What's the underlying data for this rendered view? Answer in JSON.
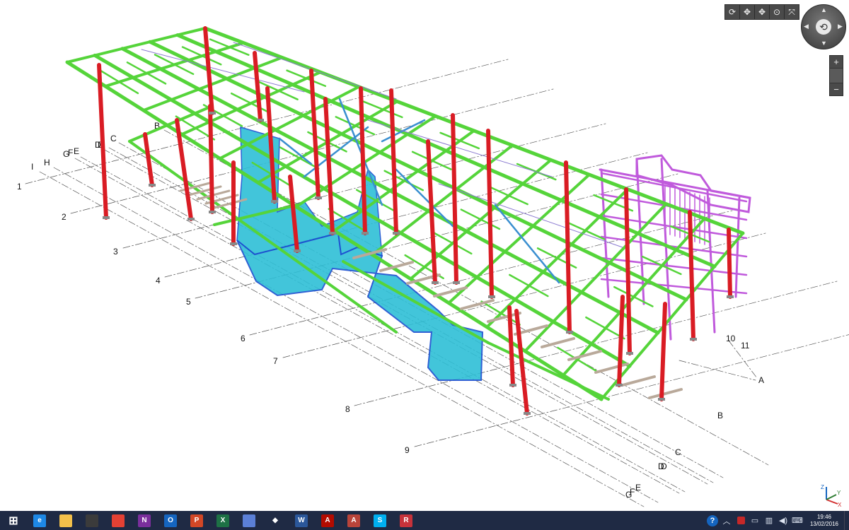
{
  "grid_axes": {
    "numbers": [
      "1",
      "2",
      "3",
      "4",
      "5",
      "6",
      "7",
      "8",
      "9",
      "10",
      "11"
    ],
    "letters_left": [
      "I",
      "H",
      "G",
      "F",
      "E",
      "D",
      "D",
      "C",
      "B"
    ],
    "letters_right": [
      "A",
      "B",
      "C",
      "D",
      "D",
      "G",
      "F",
      "E"
    ]
  },
  "colors": {
    "frame_beams": "#55d43a",
    "columns": "#d91c24",
    "cores": "#2ebfd6",
    "stair_tower": "#c05adc",
    "purlins": "#b9a99a",
    "bracing": "#8a7ad0",
    "taskbar": "#1f2a44"
  },
  "view_toolbar": {
    "buttons": [
      {
        "name": "rotate-view-icon",
        "glyph": "⟳"
      },
      {
        "name": "pan-icon",
        "glyph": "✥"
      },
      {
        "name": "move-view-icon",
        "glyph": "✥"
      },
      {
        "name": "zoom-region-icon",
        "glyph": "⊙"
      },
      {
        "name": "zoom-extents-icon",
        "glyph": "⤧"
      }
    ]
  },
  "nav_wheel": {
    "center_glyph": "⟲",
    "zoom_in": "+",
    "zoom_out": "−"
  },
  "axis_triad": {
    "x": "X",
    "y": "Y",
    "z": "Z"
  },
  "taskbar": {
    "apps": [
      {
        "name": "start-button",
        "label": "",
        "bg": "transparent",
        "glyph": "⊞"
      },
      {
        "name": "internet-explorer-icon",
        "label": "e",
        "bg": "#1e88e5"
      },
      {
        "name": "file-explorer-icon",
        "label": "",
        "bg": "#f3c04a"
      },
      {
        "name": "photos-app-icon",
        "label": "",
        "bg": "#3b3b3b"
      },
      {
        "name": "chrome-icon",
        "label": "",
        "bg": "#e44134"
      },
      {
        "name": "onenote-icon",
        "label": "N",
        "bg": "#7b2f9c"
      },
      {
        "name": "outlook-icon",
        "label": "O",
        "bg": "#1565c0"
      },
      {
        "name": "powerpoint-icon",
        "label": "P",
        "bg": "#d24726"
      },
      {
        "name": "excel-icon",
        "label": "X",
        "bg": "#1e7145"
      },
      {
        "name": "layers-app-icon",
        "label": "",
        "bg": "#5b7fd6"
      },
      {
        "name": "inkscape-icon",
        "label": "◆",
        "bg": "#1f2a44"
      },
      {
        "name": "word-icon",
        "label": "W",
        "bg": "#2b579a"
      },
      {
        "name": "acrobat-icon",
        "label": "A",
        "bg": "#b30b00"
      },
      {
        "name": "autodesk-app-icon",
        "label": "A",
        "bg": "#b9443a"
      },
      {
        "name": "skype-icon",
        "label": "S",
        "bg": "#00aff0"
      },
      {
        "name": "robot-structural-icon",
        "label": "R",
        "bg": "#c7323a"
      }
    ],
    "tray": {
      "help_glyph": "?",
      "clock_time": "19:46",
      "clock_date": "13/02/2016"
    }
  }
}
